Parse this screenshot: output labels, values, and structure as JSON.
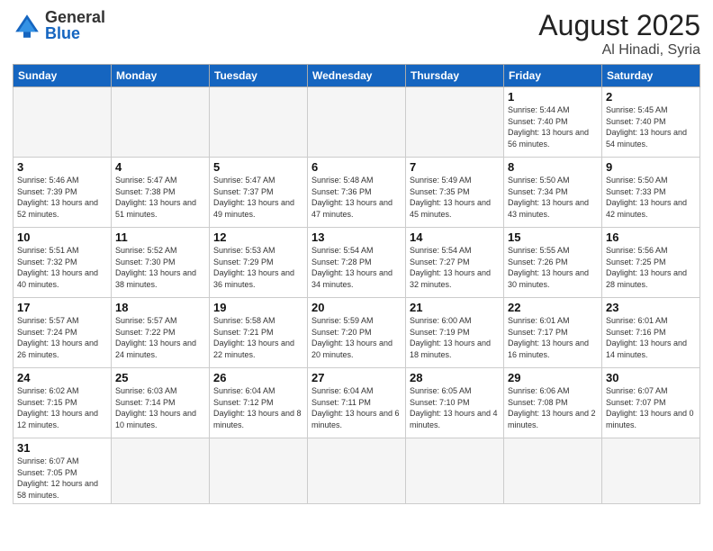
{
  "header": {
    "logo_general": "General",
    "logo_blue": "Blue",
    "month_title": "August 2025",
    "location": "Al Hinadi, Syria"
  },
  "days_of_week": [
    "Sunday",
    "Monday",
    "Tuesday",
    "Wednesday",
    "Thursday",
    "Friday",
    "Saturday"
  ],
  "weeks": [
    [
      {
        "day": "",
        "info": ""
      },
      {
        "day": "",
        "info": ""
      },
      {
        "day": "",
        "info": ""
      },
      {
        "day": "",
        "info": ""
      },
      {
        "day": "",
        "info": ""
      },
      {
        "day": "1",
        "info": "Sunrise: 5:44 AM\nSunset: 7:40 PM\nDaylight: 13 hours and 56 minutes."
      },
      {
        "day": "2",
        "info": "Sunrise: 5:45 AM\nSunset: 7:40 PM\nDaylight: 13 hours and 54 minutes."
      }
    ],
    [
      {
        "day": "3",
        "info": "Sunrise: 5:46 AM\nSunset: 7:39 PM\nDaylight: 13 hours and 52 minutes."
      },
      {
        "day": "4",
        "info": "Sunrise: 5:47 AM\nSunset: 7:38 PM\nDaylight: 13 hours and 51 minutes."
      },
      {
        "day": "5",
        "info": "Sunrise: 5:47 AM\nSunset: 7:37 PM\nDaylight: 13 hours and 49 minutes."
      },
      {
        "day": "6",
        "info": "Sunrise: 5:48 AM\nSunset: 7:36 PM\nDaylight: 13 hours and 47 minutes."
      },
      {
        "day": "7",
        "info": "Sunrise: 5:49 AM\nSunset: 7:35 PM\nDaylight: 13 hours and 45 minutes."
      },
      {
        "day": "8",
        "info": "Sunrise: 5:50 AM\nSunset: 7:34 PM\nDaylight: 13 hours and 43 minutes."
      },
      {
        "day": "9",
        "info": "Sunrise: 5:50 AM\nSunset: 7:33 PM\nDaylight: 13 hours and 42 minutes."
      }
    ],
    [
      {
        "day": "10",
        "info": "Sunrise: 5:51 AM\nSunset: 7:32 PM\nDaylight: 13 hours and 40 minutes."
      },
      {
        "day": "11",
        "info": "Sunrise: 5:52 AM\nSunset: 7:30 PM\nDaylight: 13 hours and 38 minutes."
      },
      {
        "day": "12",
        "info": "Sunrise: 5:53 AM\nSunset: 7:29 PM\nDaylight: 13 hours and 36 minutes."
      },
      {
        "day": "13",
        "info": "Sunrise: 5:54 AM\nSunset: 7:28 PM\nDaylight: 13 hours and 34 minutes."
      },
      {
        "day": "14",
        "info": "Sunrise: 5:54 AM\nSunset: 7:27 PM\nDaylight: 13 hours and 32 minutes."
      },
      {
        "day": "15",
        "info": "Sunrise: 5:55 AM\nSunset: 7:26 PM\nDaylight: 13 hours and 30 minutes."
      },
      {
        "day": "16",
        "info": "Sunrise: 5:56 AM\nSunset: 7:25 PM\nDaylight: 13 hours and 28 minutes."
      }
    ],
    [
      {
        "day": "17",
        "info": "Sunrise: 5:57 AM\nSunset: 7:24 PM\nDaylight: 13 hours and 26 minutes."
      },
      {
        "day": "18",
        "info": "Sunrise: 5:57 AM\nSunset: 7:22 PM\nDaylight: 13 hours and 24 minutes."
      },
      {
        "day": "19",
        "info": "Sunrise: 5:58 AM\nSunset: 7:21 PM\nDaylight: 13 hours and 22 minutes."
      },
      {
        "day": "20",
        "info": "Sunrise: 5:59 AM\nSunset: 7:20 PM\nDaylight: 13 hours and 20 minutes."
      },
      {
        "day": "21",
        "info": "Sunrise: 6:00 AM\nSunset: 7:19 PM\nDaylight: 13 hours and 18 minutes."
      },
      {
        "day": "22",
        "info": "Sunrise: 6:01 AM\nSunset: 7:17 PM\nDaylight: 13 hours and 16 minutes."
      },
      {
        "day": "23",
        "info": "Sunrise: 6:01 AM\nSunset: 7:16 PM\nDaylight: 13 hours and 14 minutes."
      }
    ],
    [
      {
        "day": "24",
        "info": "Sunrise: 6:02 AM\nSunset: 7:15 PM\nDaylight: 13 hours and 12 minutes."
      },
      {
        "day": "25",
        "info": "Sunrise: 6:03 AM\nSunset: 7:14 PM\nDaylight: 13 hours and 10 minutes."
      },
      {
        "day": "26",
        "info": "Sunrise: 6:04 AM\nSunset: 7:12 PM\nDaylight: 13 hours and 8 minutes."
      },
      {
        "day": "27",
        "info": "Sunrise: 6:04 AM\nSunset: 7:11 PM\nDaylight: 13 hours and 6 minutes."
      },
      {
        "day": "28",
        "info": "Sunrise: 6:05 AM\nSunset: 7:10 PM\nDaylight: 13 hours and 4 minutes."
      },
      {
        "day": "29",
        "info": "Sunrise: 6:06 AM\nSunset: 7:08 PM\nDaylight: 13 hours and 2 minutes."
      },
      {
        "day": "30",
        "info": "Sunrise: 6:07 AM\nSunset: 7:07 PM\nDaylight: 13 hours and 0 minutes."
      }
    ],
    [
      {
        "day": "31",
        "info": "Sunrise: 6:07 AM\nSunset: 7:05 PM\nDaylight: 12 hours and 58 minutes."
      },
      {
        "day": "",
        "info": ""
      },
      {
        "day": "",
        "info": ""
      },
      {
        "day": "",
        "info": ""
      },
      {
        "day": "",
        "info": ""
      },
      {
        "day": "",
        "info": ""
      },
      {
        "day": "",
        "info": ""
      }
    ]
  ]
}
